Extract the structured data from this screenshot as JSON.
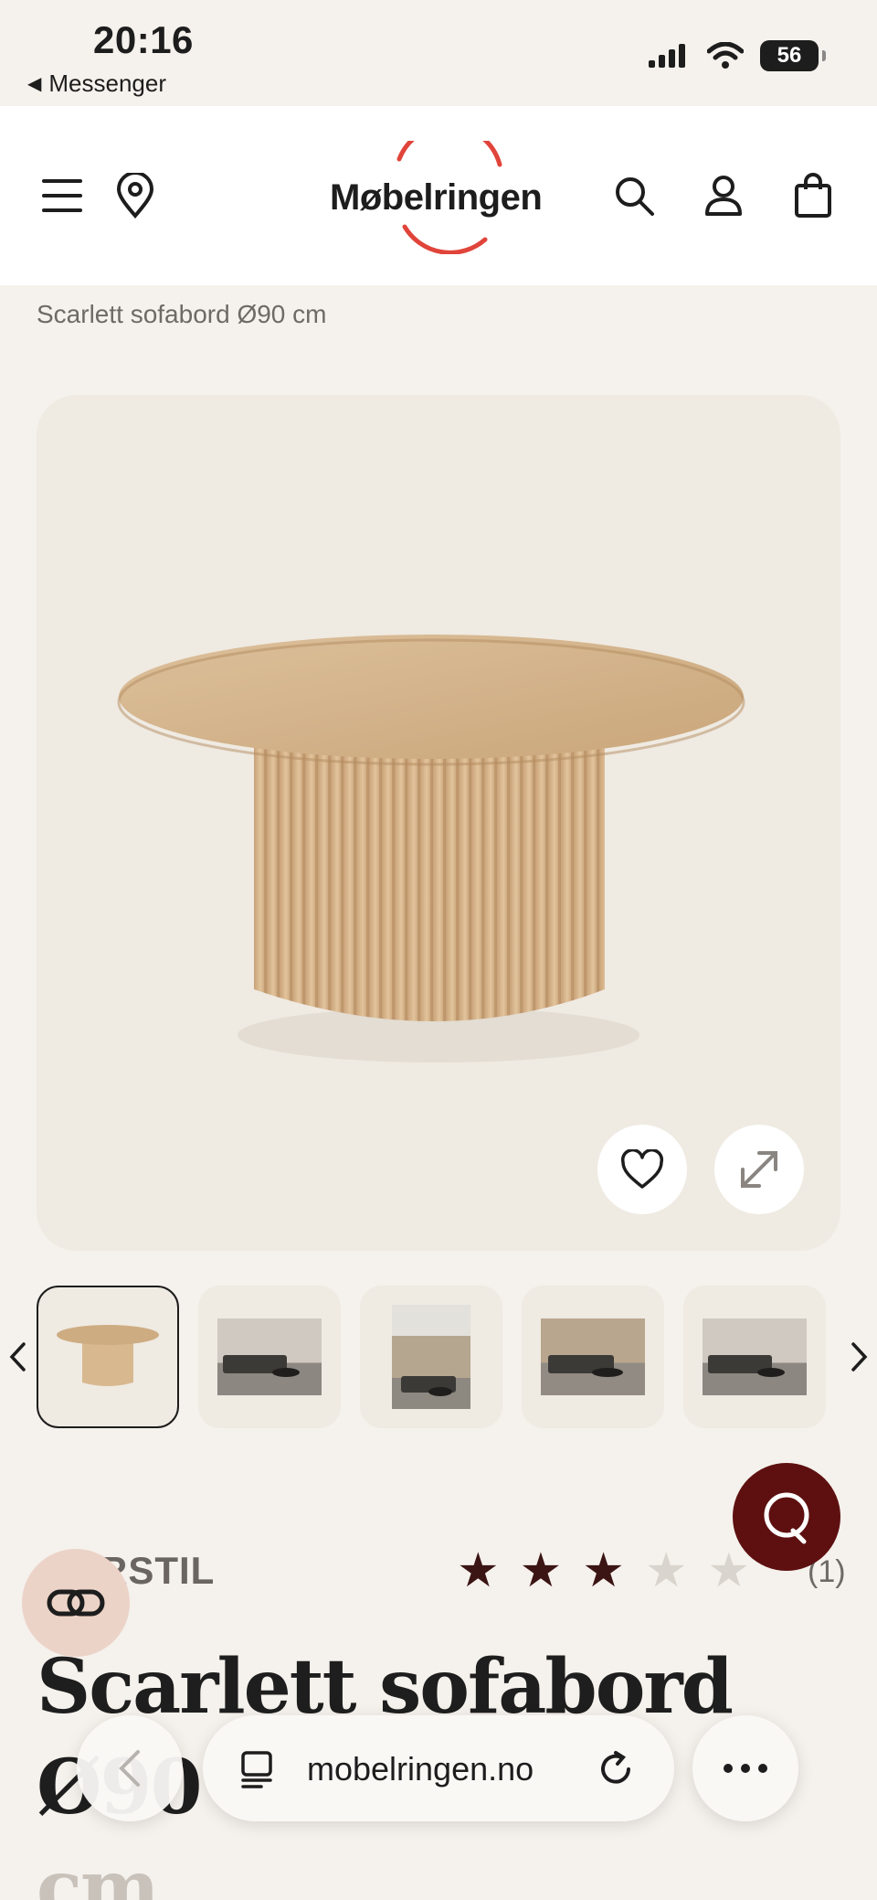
{
  "status": {
    "time": "20:16",
    "back_app": "Messenger",
    "battery": "56"
  },
  "header": {
    "logo": "Møbelringen",
    "icons": [
      "menu-icon",
      "location-pin-icon",
      "search-icon",
      "user-icon",
      "shopping-bag-icon"
    ]
  },
  "breadcrumb": "Scarlett sofabord Ø90 cm",
  "gallery": {
    "thumbnails": [
      "table",
      "living-room",
      "living-room-tall",
      "living-room",
      "living-room"
    ],
    "active_index": 0
  },
  "product": {
    "brand": "INTERSTIL",
    "brand_visible": "ERSTIL",
    "rating": 3,
    "rating_max": 5,
    "review_count": "(1)",
    "title_line1": "Scarlett sofabord Ø90",
    "title_line2": "cm"
  },
  "browser": {
    "url": "mobelringen.no"
  },
  "colors": {
    "background": "#f5f1ec",
    "accent": "#5e1010",
    "star_on": "#3b1414",
    "logo_ring": "#e0443a"
  }
}
